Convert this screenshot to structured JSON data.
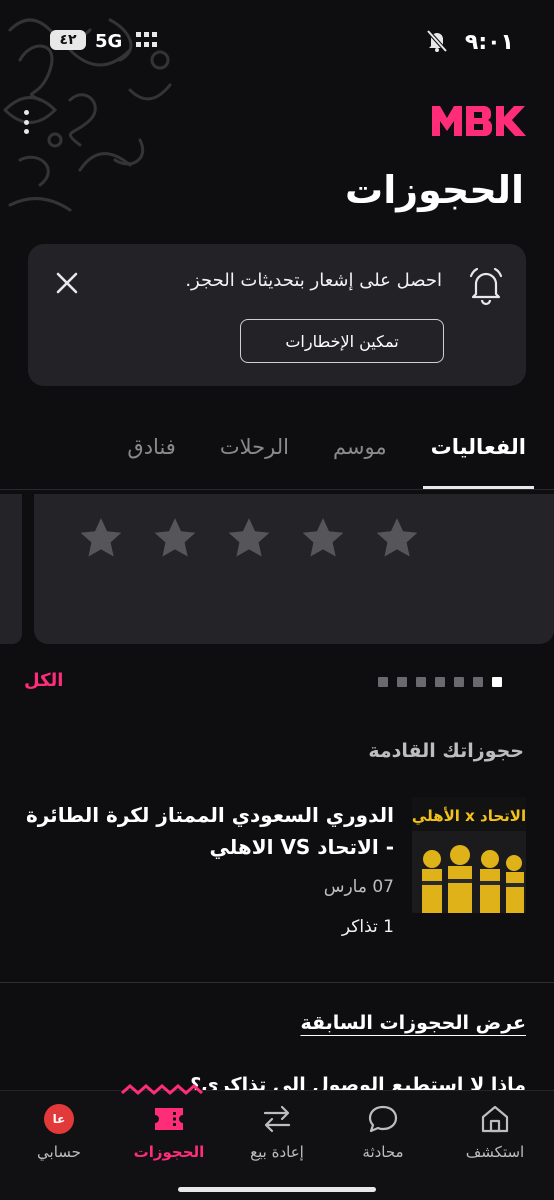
{
  "status_bar": {
    "time": "٩:٠١",
    "network": "5G",
    "battery": "٤٢"
  },
  "header": {
    "logo_text": "MBK",
    "title": "الحجوزات"
  },
  "notification": {
    "message": "احصل على إشعار بتحديثات الحجز.",
    "button_label": "تمكين الإخطارات"
  },
  "tabs": [
    {
      "label": "الفعاليات",
      "active": true
    },
    {
      "label": "موسم",
      "active": false
    },
    {
      "label": "الرحلات",
      "active": false
    },
    {
      "label": "فنادق",
      "active": false
    }
  ],
  "rating": {
    "stars_total": 5,
    "stars_filled": 0
  },
  "carousel": {
    "pages": 7,
    "current": 1,
    "all_label": "الكل"
  },
  "upcoming": {
    "section_title": "حجوزاتك القادمة",
    "booking": {
      "title": "الدوري السعودي الممتاز لكرة الطائرة - الاتحاد VS الاهلي",
      "date": "07 مارس",
      "tickets": "1 تذاكر",
      "thumb_text": "الاتحاد x الأهلي"
    }
  },
  "past_link": "عرض الحجوزات السابقة",
  "faq_peek": "ماذا لا استطيع الوصول الى تذاكري؟",
  "nav": {
    "items": [
      {
        "key": "explore",
        "label": "استكشف",
        "icon": "home-icon"
      },
      {
        "key": "chat",
        "label": "محادثة",
        "icon": "chat-bubble-icon"
      },
      {
        "key": "resale",
        "label": "إعادة بيع",
        "icon": "swap-arrows-icon"
      },
      {
        "key": "bookings",
        "label": "الحجوزات",
        "icon": "ticket-icon",
        "active": true
      },
      {
        "key": "account",
        "label": "حسابي",
        "icon": "avatar-icon",
        "avatar_initials": "عا"
      }
    ]
  },
  "colors": {
    "accent": "#ff2d78",
    "background": "#0e0e10",
    "card": "#232327"
  }
}
